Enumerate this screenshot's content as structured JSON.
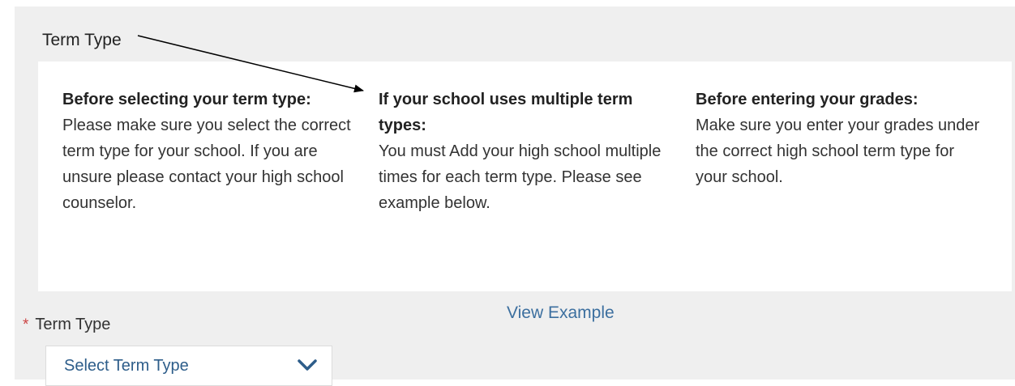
{
  "section": {
    "title": "Term Type"
  },
  "info": {
    "col1": {
      "heading": "Before selecting your term type:",
      "body": "Please make sure you select the correct term type for your school. If you are unsure please contact your high school counselor."
    },
    "col2": {
      "heading": "If your school uses multiple term types:",
      "body": "You must Add your high school multiple times for each term type. Please see example below."
    },
    "col3": {
      "heading": "Before entering your grades:",
      "body": "Make sure you enter your grades under the correct high school term type for your school."
    },
    "link_label": "View Example"
  },
  "field": {
    "required_marker": "*",
    "label": "Term Type",
    "selected_value": "Select Term Type"
  },
  "icons": {
    "required": "asterisk-icon",
    "dropdown": "chevron-down-icon",
    "annotation": "arrow-icon"
  },
  "colors": {
    "background": "#efefef",
    "panel": "#ffffff",
    "link": "#3c6f9f",
    "select_text": "#2d5d8a",
    "required": "#c44444"
  }
}
